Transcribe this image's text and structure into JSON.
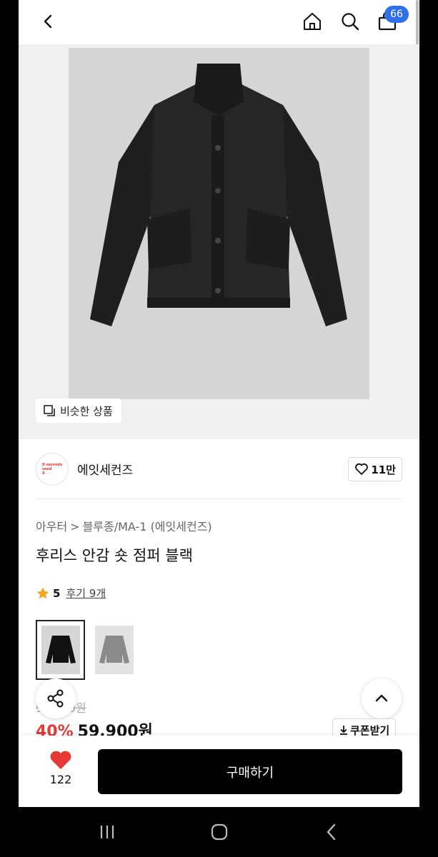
{
  "header": {
    "cart_count": "66"
  },
  "image": {
    "similar_label": "비슷한 상품"
  },
  "brand": {
    "name": "에잇세컨즈",
    "logo_lines": [
      "8 seconds",
      "seed",
      "8"
    ],
    "like_count": "11만"
  },
  "product": {
    "breadcrumb": [
      "아우터",
      "블루종/MA-1 (에잇세컨즈)"
    ],
    "breadcrumb_sep": ">",
    "title": "후리스 안감 숏 점퍼 블랙",
    "rating": "5",
    "reviews": "후기 9개",
    "old_price": "99,900원",
    "discount": "40%",
    "price": "59,900원",
    "coupon_label": "쿠폰받기"
  },
  "thumbnails": [
    {
      "color": "#111111",
      "active": true
    },
    {
      "color": "#8a8a8a",
      "active": false
    }
  ],
  "bottom": {
    "wish_count": "122",
    "buy_label": "구매하기"
  },
  "colors": {
    "accent_red": "#e53935",
    "badge_blue": "#2f6fe8",
    "star": "#f5a623"
  },
  "icons": [
    "back-arrow-icon",
    "home-icon",
    "search-icon",
    "shopping-bag-icon",
    "copy-icon",
    "heart-outline-icon",
    "star-icon",
    "share-icon",
    "chevron-up-icon",
    "download-icon",
    "heart-filled-icon",
    "recent-apps-icon",
    "home-circle-icon",
    "system-back-icon"
  ]
}
